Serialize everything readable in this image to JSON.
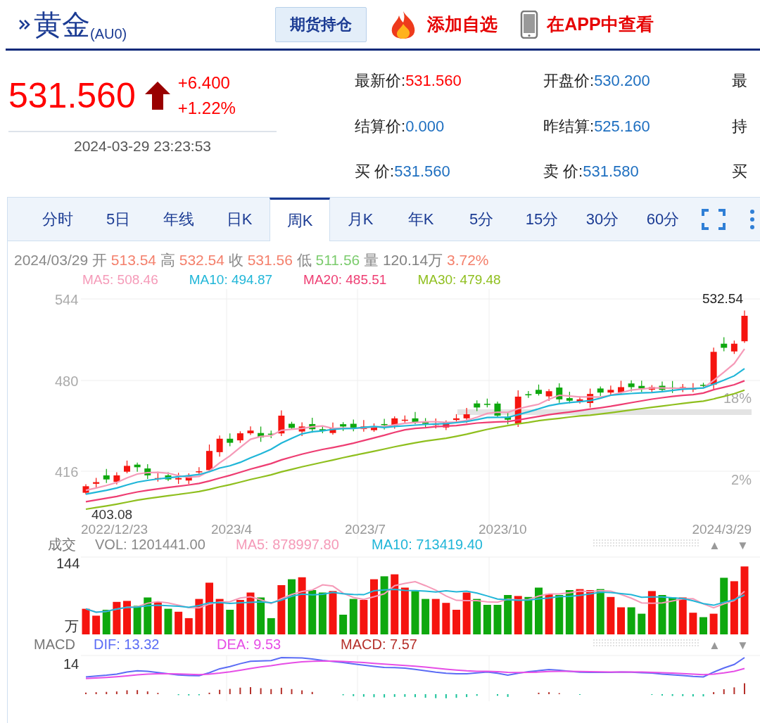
{
  "header": {
    "title": "黄金",
    "code": "(AU0)",
    "button": "期货持仓",
    "actions": [
      {
        "kind": "flame",
        "label": "添加自选"
      },
      {
        "kind": "phone",
        "label": "在APP中查看"
      }
    ]
  },
  "quote": {
    "price": "531.560",
    "rising": true,
    "change": "+6.400",
    "change_percent": "+1.22%",
    "time": "2024-03-29 23:23:53"
  },
  "fields": [
    {
      "label": "最新价:",
      "value": "531.560",
      "color": "#ff0000"
    },
    {
      "label": "开盘价:",
      "value": "530.200",
      "color": "#1e6fc0"
    },
    {
      "label": "最"
    },
    {
      "label": "结算价:",
      "value": "0.000",
      "color": "#1e6fc0"
    },
    {
      "label": "昨结算:",
      "value": "525.160",
      "color": "#1e6fc0"
    },
    {
      "label": "持"
    },
    {
      "label": "买 价:",
      "value": "531.560",
      "color": "#1e6fc0"
    },
    {
      "label": "卖 价:",
      "value": "531.580",
      "color": "#1e6fc0"
    },
    {
      "label": "买"
    }
  ],
  "tabs": [
    {
      "label": "分时",
      "selected": false
    },
    {
      "label": "5日",
      "selected": false
    },
    {
      "label": "年线",
      "selected": false
    },
    {
      "label": "日K",
      "selected": false
    },
    {
      "label": "周K",
      "selected": true
    },
    {
      "label": "月K",
      "selected": false
    },
    {
      "label": "年K",
      "selected": false
    },
    {
      "label": "5分",
      "selected": false
    },
    {
      "label": "15分",
      "selected": false
    },
    {
      "label": "30分",
      "selected": false
    },
    {
      "label": "60分",
      "selected": false
    }
  ],
  "kline": {
    "date": "2024/03/29",
    "stats": [
      {
        "label": "开",
        "value": "513.54",
        "color": "#f4806c"
      },
      {
        "label": "高",
        "value": "532.54",
        "color": "#f4806c"
      },
      {
        "label": "收",
        "value": "531.56",
        "color": "#f4806c"
      },
      {
        "label": "低",
        "value": "511.56",
        "color": "#7ccc6e"
      },
      {
        "label": "量",
        "value": "120.14万",
        "color": "#808080"
      }
    ],
    "percent": "3.72%",
    "ma": [
      {
        "text": "MA5: 508.46",
        "color": "#f59ab8"
      },
      {
        "text": "MA10: 494.87",
        "color": "#20b6d8"
      },
      {
        "text": "MA20: 485.51",
        "color": "#ee3d72"
      },
      {
        "text": "MA30: 479.48",
        "color": "#8fbf1e"
      }
    ],
    "y_labels": [
      "544",
      "480",
      "416"
    ],
    "percent_labels": [
      "18%",
      "2%"
    ],
    "high_label": "532.54",
    "low_label": "403.08",
    "x_labels": [
      "2022/12/23",
      "2023/4",
      "2023/7",
      "2023/10",
      "2024/3/29"
    ]
  },
  "volume": {
    "title": "成交",
    "reading": "VOL: 1201441.00",
    "ma": [
      {
        "text": "MA5: 878997.80",
        "color": "#f59ab8"
      },
      {
        "text": "MA10: 713419.40",
        "color": "#20b6d8"
      }
    ],
    "top_label": "144",
    "unit": "万",
    "up": "▲",
    "down": "▼"
  },
  "macd": {
    "title": "MACD",
    "lines": [
      {
        "text": "DIF: 13.32",
        "color": "#5b6cf5"
      },
      {
        "text": "DEA: 9.53",
        "color": "#e64ee6"
      },
      {
        "text": "MACD: 7.57",
        "color": "#b5302a"
      }
    ],
    "top_label": "14",
    "up": "▲",
    "down": "▼"
  }
}
